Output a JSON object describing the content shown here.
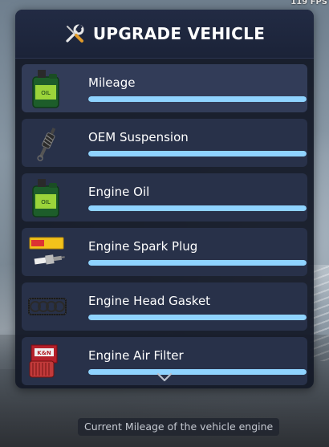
{
  "hud": {
    "fps": "119 FPS"
  },
  "panel": {
    "title": "UPGRADE VEHICLE",
    "header_icon": "tools-icon",
    "accent": "#8fd3ff",
    "items": [
      {
        "label": "Mileage",
        "icon": "oil-bottle-icon",
        "progress": 1.0
      },
      {
        "label": "OEM Suspension",
        "icon": "shock-absorber-icon",
        "progress": 1.0
      },
      {
        "label": "Engine Oil",
        "icon": "oil-bottle-icon",
        "progress": 1.0
      },
      {
        "label": "Engine Spark Plug",
        "icon": "spark-plug-icon",
        "progress": 1.0
      },
      {
        "label": "Engine Head Gasket",
        "icon": "head-gasket-icon",
        "progress": 1.0
      },
      {
        "label": "Engine Air Filter",
        "icon": "air-filter-icon",
        "progress": 1.0
      }
    ],
    "scroll_icon": "chevron-down-icon"
  },
  "tooltip": {
    "text": "Current Mileage of the vehicle engine"
  }
}
